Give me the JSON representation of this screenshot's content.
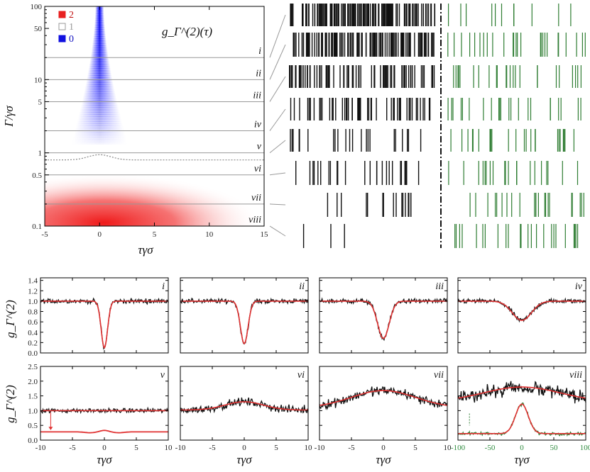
{
  "colors": {
    "high": "#e82020",
    "mid": "#999999",
    "low": "#1010e0",
    "fit": "#e03030",
    "green": "#2e7d32",
    "black": "#111111"
  },
  "chart_data": [
    {
      "type": "heatmap",
      "title": "g_Γ^(2)(τ)",
      "xlabel": "τγσ",
      "ylabel": "Γ/γσ",
      "xlim": [
        -5,
        15
      ],
      "ylim": [
        0.1,
        100
      ],
      "yscale": "log",
      "xticks": [
        "-5",
        "0",
        "5",
        "10",
        "15"
      ],
      "yticks": [
        "0.1",
        "0.5",
        "1",
        "5",
        "10",
        "50",
        "100"
      ],
      "legend": [
        {
          "label": "2"
        },
        {
          "label": "1"
        },
        {
          "label": "0"
        }
      ],
      "cut_levels": [
        {
          "label": "i",
          "gamma": 20
        },
        {
          "label": "ii",
          "gamma": 10
        },
        {
          "label": "iii",
          "gamma": 5
        },
        {
          "label": "iv",
          "gamma": 2
        },
        {
          "label": "v",
          "gamma": 1
        },
        {
          "label": "vi",
          "gamma": 0.5
        },
        {
          "label": "vii",
          "gamma": 0.2
        },
        {
          "label": "viii",
          "gamma": 0.1
        }
      ],
      "boundary_gamma": 0.8
    },
    {
      "type": "line",
      "panels": [
        {
          "label": "i",
          "ylim": [
            0,
            1.45
          ],
          "yticks": [
            "0.0",
            "0.2",
            "0.4",
            "0.6",
            "0.8",
            "1.0",
            "1.2",
            "1.4"
          ],
          "dip_center": 0,
          "min_value": 0.1,
          "baseline": 1.0,
          "width": 0.5
        },
        {
          "label": "ii",
          "ylim": [
            0,
            1.45
          ],
          "dip_center": 0,
          "min_value": 0.18,
          "baseline": 1.0,
          "width": 0.6
        },
        {
          "label": "iii",
          "ylim": [
            0,
            1.45
          ],
          "dip_center": 0,
          "min_value": 0.28,
          "baseline": 1.0,
          "width": 0.9
        },
        {
          "label": "iv",
          "ylim": [
            0,
            1.45
          ],
          "dip_center": 0,
          "min_value": 0.63,
          "baseline": 1.0,
          "width": 1.5
        },
        {
          "label": "v",
          "ylim": [
            0,
            2.5
          ],
          "yticks": [
            "0.0",
            "0.5",
            "1.0",
            "1.5",
            "2.0",
            "2.5"
          ],
          "peak_center": 0,
          "peak_value": 1.0,
          "baseline": 1.0,
          "width": 2
        },
        {
          "label": "vi",
          "ylim": [
            0,
            2.5
          ],
          "peak_center": 0,
          "peak_value": 1.3,
          "baseline": 1.02,
          "width": 3
        },
        {
          "label": "vii",
          "ylim": [
            0,
            2.5
          ],
          "peak_center": 0,
          "peak_value": 1.68,
          "baseline": 1.1,
          "width": 5
        },
        {
          "label": "viii",
          "ylim": [
            0,
            2.5
          ],
          "peak_center": 0,
          "peak_value": 1.8,
          "baseline": 1.3,
          "width": 6
        }
      ],
      "xlim": [
        -10,
        10
      ],
      "xticks": [
        "-10",
        "-5",
        "0",
        "5",
        "10"
      ],
      "xlabel": "τγσ",
      "ylabel": "g_Γ^(2)",
      "green_xticks": [
        "-100",
        "-50",
        "0",
        "50",
        "100"
      ]
    }
  ]
}
